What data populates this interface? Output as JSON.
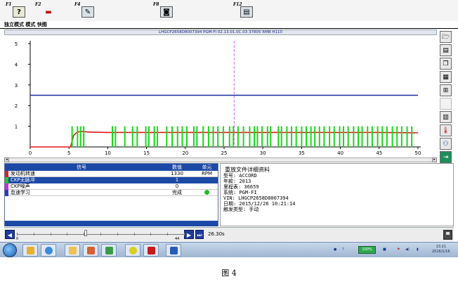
{
  "toolbar": {
    "keys": [
      {
        "label": "F1",
        "icon": "help-icon",
        "glyph": "?"
      },
      {
        "label": "F2",
        "icon": "vehicle-icon",
        "glyph": "▬"
      },
      {
        "label": "F4",
        "icon": "tools-icon",
        "glyph": "✎"
      },
      {
        "label": "F8",
        "icon": "save-record-icon",
        "glyph": "◙"
      },
      {
        "label": "F12",
        "icon": "print-icon",
        "glyph": "▤"
      }
    ]
  },
  "menu": {
    "label": "独立模式 模式 快图"
  },
  "vehicle_header": "LHGCP2658D8007394 PGM-FI 02.13.01.0C.03 37805 RMB H110",
  "chart_data": {
    "type": "line",
    "xlim": [
      0,
      50
    ],
    "ylim": [
      0,
      5
    ],
    "xticks": [
      0,
      5,
      10,
      15,
      20,
      25,
      30,
      35,
      40,
      45,
      50
    ],
    "yticks": [
      1,
      2,
      3,
      4,
      5
    ],
    "cursor_x": 26.3,
    "series": [
      {
        "color": "#1a2a9a",
        "values": [
          {
            "x": 0,
            "y": 2.5
          },
          {
            "x": 50,
            "y": 2.5
          }
        ]
      },
      {
        "color": "#e01818",
        "values": [
          {
            "x": 0,
            "y": 0
          },
          {
            "x": 5.2,
            "y": 0
          },
          {
            "x": 5.6,
            "y": 0.55
          },
          {
            "x": 6.0,
            "y": 0.7
          },
          {
            "x": 6.5,
            "y": 0.75
          },
          {
            "x": 7.5,
            "y": 0.72
          },
          {
            "x": 10,
            "y": 0.7
          },
          {
            "x": 15,
            "y": 0.7
          },
          {
            "x": 20,
            "y": 0.7
          },
          {
            "x": 25,
            "y": 0.7
          },
          {
            "x": 30,
            "y": 0.7
          },
          {
            "x": 35,
            "y": 0.7
          },
          {
            "x": 40,
            "y": 0.7
          },
          {
            "x": 45,
            "y": 0.7
          },
          {
            "x": 50,
            "y": 0.68
          }
        ]
      },
      {
        "color": "#18d818",
        "type": "pulses",
        "baseline": 0,
        "level": 1.0,
        "pulses": [
          5.4,
          6.1,
          6.5,
          6.9,
          10.6,
          11.0,
          12.2,
          13.2,
          13.8,
          14.9,
          15.3,
          16.0,
          16.4,
          17.6,
          18.3,
          19.0,
          19.6,
          20.2,
          21.1,
          21.5,
          22.3,
          23.0,
          23.6,
          24.2,
          24.9,
          25.7,
          26.2,
          26.8,
          27.5,
          28.3,
          28.9,
          29.3,
          29.9,
          30.6,
          31.0,
          32.0,
          32.4,
          33.1,
          33.7,
          34.3,
          35.0,
          35.6,
          36.2,
          36.7,
          37.3,
          37.9,
          38.6,
          39.2,
          39.9,
          40.4,
          41.0,
          41.7,
          42.3,
          42.8,
          43.5,
          44.1,
          44.8,
          45.4,
          46.0,
          46.7,
          47.3,
          47.9,
          48.6,
          49.2
        ]
      }
    ]
  },
  "right_toolbar": {
    "icons": [
      "open-folder-icon",
      "print-icon",
      "copy-icon",
      "page-icon",
      "zoom-icon",
      "blank-icon",
      "freeze-frame-icon",
      "thermometer-icon",
      "connector-icon",
      "exit-icon"
    ]
  },
  "table": {
    "headers": [
      "信号",
      "数值",
      "单元"
    ],
    "rows": [
      {
        "name": "发动机转速",
        "value": "1330",
        "unit": "RPM",
        "color": "#e81c1c",
        "selected": false
      },
      {
        "name": "CKP无脉冲",
        "value": "1",
        "unit": "",
        "color": "#20c820",
        "selected": true
      },
      {
        "name": "CKP噪声",
        "value": "0",
        "unit": "",
        "color": "#d828d8",
        "selected": false
      },
      {
        "name": "怠速学习",
        "value": "完成",
        "unit": "●",
        "color": "#2a3bc8",
        "selected": false
      }
    ]
  },
  "info_panel": {
    "title": "重放文件详细资料",
    "lines": [
      "型号: ACCORD",
      "年款: 2013",
      "里程表: 36659",
      "系统: PGM-FI",
      "VIN: LHGCP2658D8007394",
      "日期: 2015/12/26 10:21:14",
      "触发类型: 手动"
    ]
  },
  "timeline": {
    "min_label": "0",
    "max_label": "44",
    "time_value": "26.30s",
    "position": 0.41
  },
  "taskbar": {
    "volume_label": "100%",
    "clock_time": "13:21",
    "clock_date": "2016/1/16"
  },
  "caption": "图 4"
}
